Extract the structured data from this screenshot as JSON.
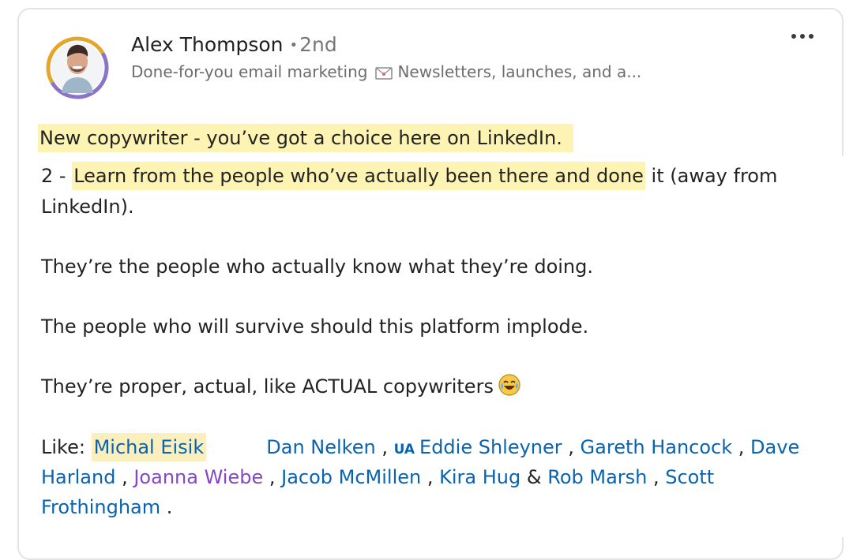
{
  "post": {
    "author_name": "Alex Thompson",
    "separator": "•",
    "degree": "2nd",
    "headline_part1": "Done-for-you email marketing",
    "headline_part2": "Newsletters, launches, and a...",
    "line1_highlight": "New copywriter - you’ve got a choice here on LinkedIn.",
    "line2_prefix": "2 - ",
    "line2_highlight": "Learn from the people who’ve actually been there and done",
    "line2_suffix": " it (away from",
    "line3": "LinkedIn).",
    "line4": "They’re the people who actually know what they’re doing.",
    "line5": "The people who will survive should this platform implode.",
    "line6": "They’re proper, actual, like ACTUAL copywriters",
    "like_label": "Like: ",
    "mentions": {
      "michal": "Michal Eisik",
      "dan": "Dan Nelken",
      "ua_flag": "UA",
      "eddie": "Eddie Shleyner",
      "gareth": "Gareth Hancock",
      "dave_1": "Dave",
      "dave_2": "Harland",
      "joanna": "Joanna Wiebe",
      "jacob": "Jacob McMillen",
      "kira": "Kira Hug",
      "rob": "Rob Marsh",
      "scott_1": "Scott",
      "scott_2": "Frothingham"
    },
    "sep_comma": " , ",
    "sep_amp": " & ",
    "final_period": " ."
  },
  "colors": {
    "highlight": "#fdf4b3",
    "mention_blue": "#0a63b0",
    "mention_purple": "#8448c4"
  },
  "icons": [
    "avatar-photo",
    "envelope-icon",
    "more-options-icon",
    "laughing-emoji-icon"
  ]
}
